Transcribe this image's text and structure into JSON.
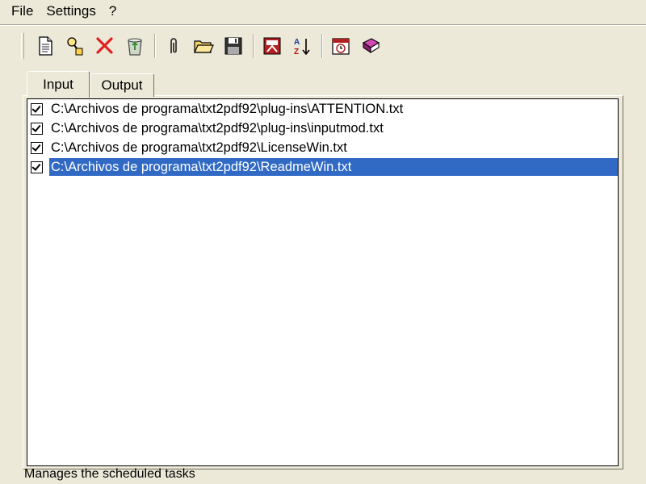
{
  "menu": {
    "file": "File",
    "settings": "Settings",
    "help": "?"
  },
  "toolbar": {
    "icons": [
      "new-document-icon",
      "find-icon",
      "delete-icon",
      "recycle-icon",
      "attach-icon",
      "open-folder-icon",
      "save-icon",
      "convert-pdf-icon",
      "sort-az-icon",
      "schedule-icon",
      "book-icon"
    ]
  },
  "tabs": {
    "input": "Input",
    "output": "Output",
    "active": "Input"
  },
  "files": [
    {
      "path": "C:\\Archivos de programa\\txt2pdf92\\plug-ins\\ATTENTION.txt",
      "checked": true,
      "selected": false
    },
    {
      "path": "C:\\Archivos de programa\\txt2pdf92\\plug-ins\\inputmod.txt",
      "checked": true,
      "selected": false
    },
    {
      "path": "C:\\Archivos de programa\\txt2pdf92\\LicenseWin.txt",
      "checked": true,
      "selected": false
    },
    {
      "path": "C:\\Archivos de programa\\txt2pdf92\\ReadmeWin.txt",
      "checked": true,
      "selected": true
    }
  ],
  "status": {
    "text": "Manages the scheduled tasks"
  },
  "colors": {
    "selection": "#316ac5",
    "face": "#ece9d8",
    "delete": "#e02020"
  }
}
